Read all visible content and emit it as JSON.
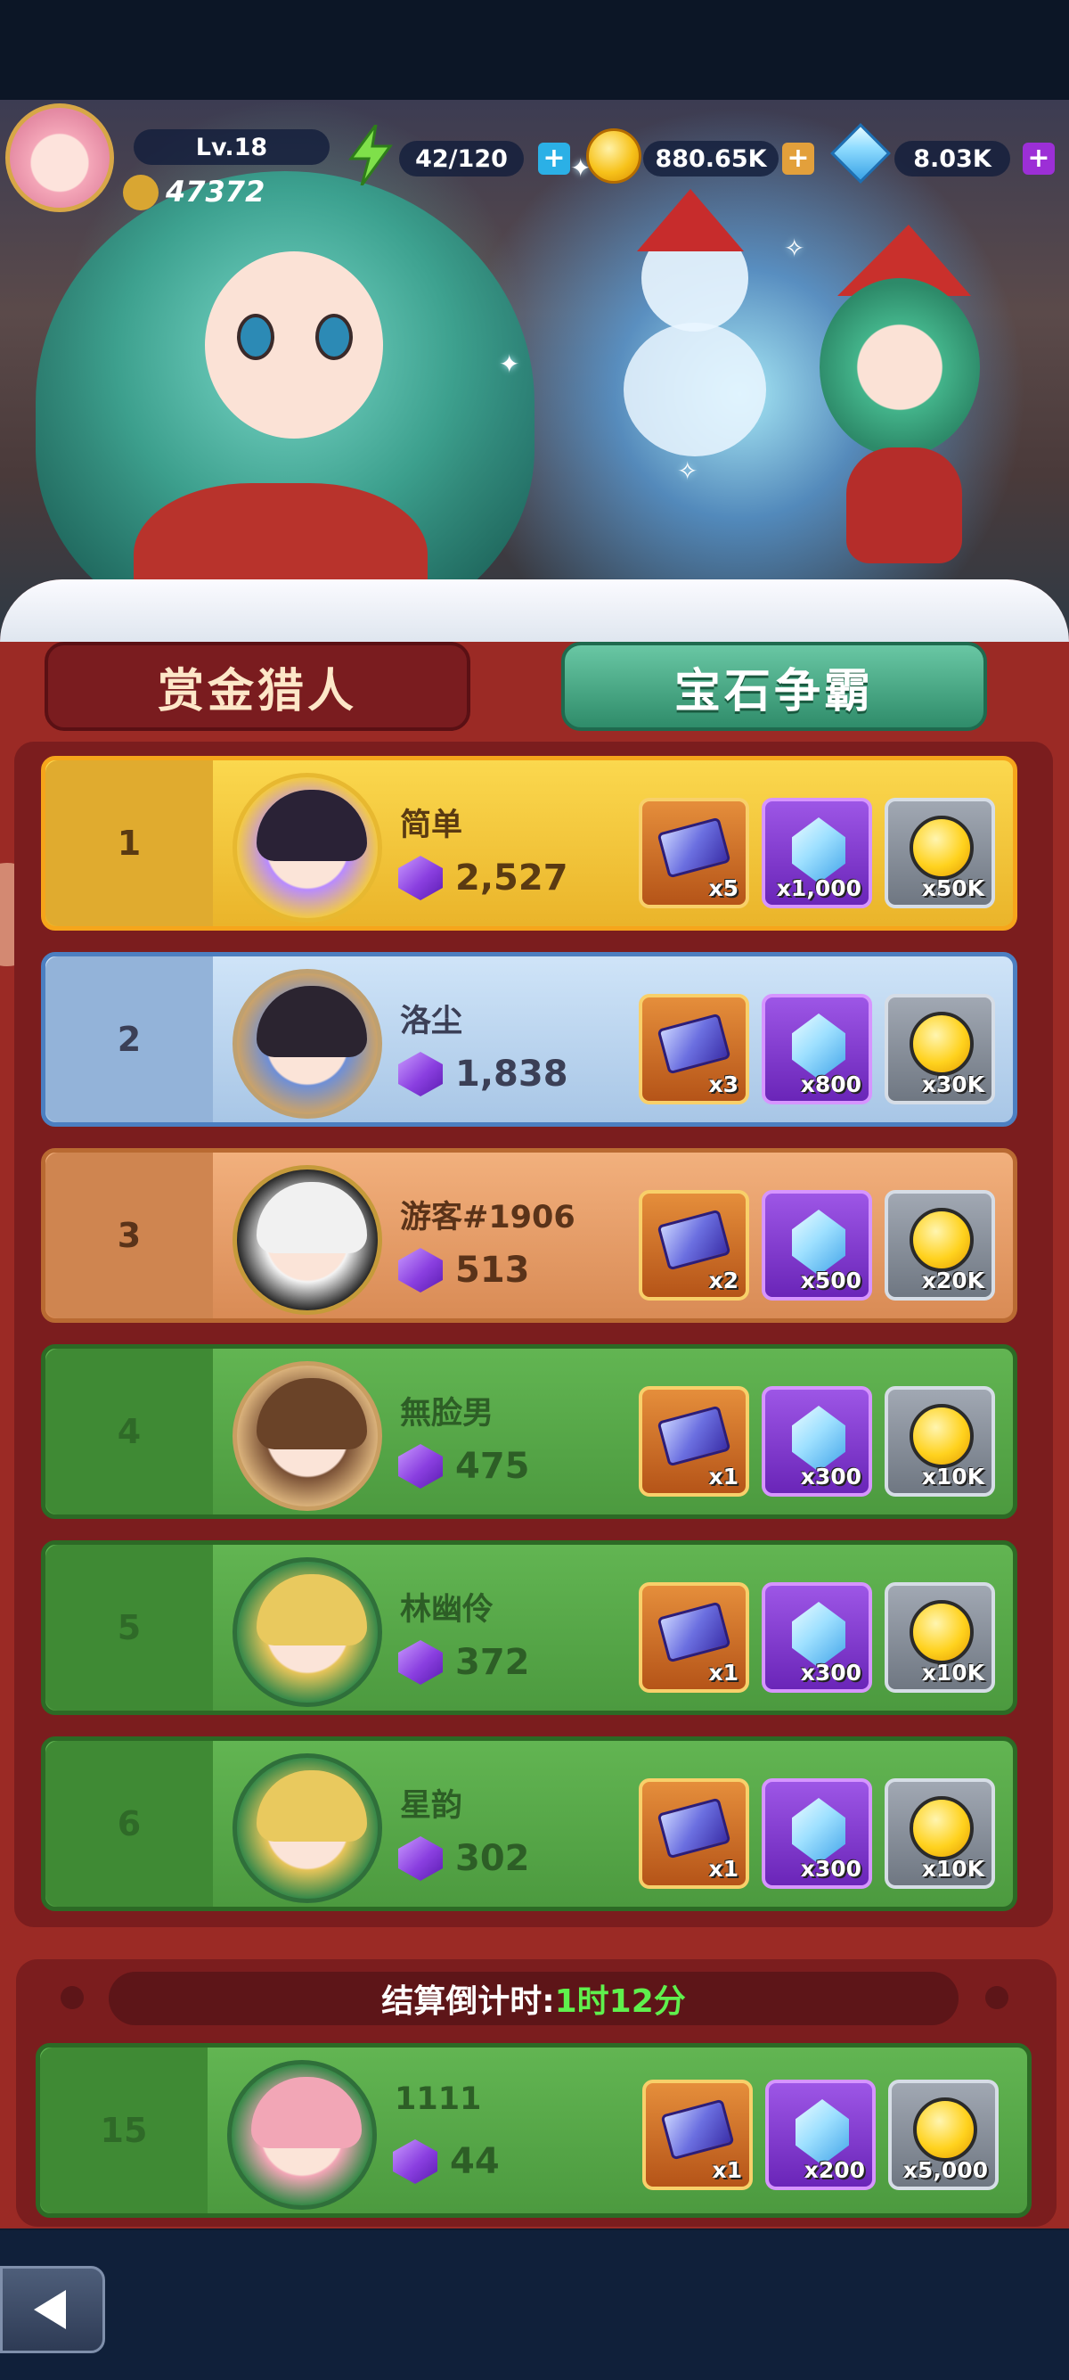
{
  "player": {
    "level": "Lv.18",
    "power": "47372"
  },
  "resources": {
    "energy": "42/120",
    "coins": "880.65K",
    "gems": "8.03K"
  },
  "tabs": [
    {
      "label": "赏金猎人",
      "active": false
    },
    {
      "label": "宝石争霸",
      "active": true
    }
  ],
  "leaderboard": [
    {
      "rank": "1",
      "name": "简单",
      "score": "2,527",
      "tier": "gold",
      "rewards": {
        "ticket": "x5",
        "gem": "x1,000",
        "coin": "x50K"
      }
    },
    {
      "rank": "2",
      "name": "洛尘",
      "score": "1,838",
      "tier": "silver",
      "rewards": {
        "ticket": "x3",
        "gem": "x800",
        "coin": "x30K"
      }
    },
    {
      "rank": "3",
      "name": "游客#1906",
      "score": "513",
      "tier": "bronze",
      "rewards": {
        "ticket": "x2",
        "gem": "x500",
        "coin": "x20K"
      }
    },
    {
      "rank": "4",
      "name": "無脸男",
      "score": "475",
      "tier": "green",
      "rewards": {
        "ticket": "x1",
        "gem": "x300",
        "coin": "x10K"
      }
    },
    {
      "rank": "5",
      "name": "林幽伶",
      "score": "372",
      "tier": "green",
      "rewards": {
        "ticket": "x1",
        "gem": "x300",
        "coin": "x10K"
      }
    },
    {
      "rank": "6",
      "name": "星韵",
      "score": "302",
      "tier": "green",
      "rewards": {
        "ticket": "x1",
        "gem": "x300",
        "coin": "x10K"
      }
    }
  ],
  "countdown": {
    "label": "结算倒计时:",
    "value": "1时12分"
  },
  "self_entry": {
    "rank": "15",
    "name": "1111",
    "score": "44",
    "rewards": {
      "ticket": "x1",
      "gem": "x200",
      "coin": "x5,000"
    }
  },
  "colors": {
    "panel": "#9b2a25",
    "active_tab": "#2f8c6a",
    "countdown_value": "#5ff04d"
  },
  "icons": [
    "back-arrow-icon",
    "energy-bolt-icon",
    "coin-icon",
    "diamond-icon",
    "purple-gem-icon",
    "ticket-icon",
    "plus-icon"
  ]
}
